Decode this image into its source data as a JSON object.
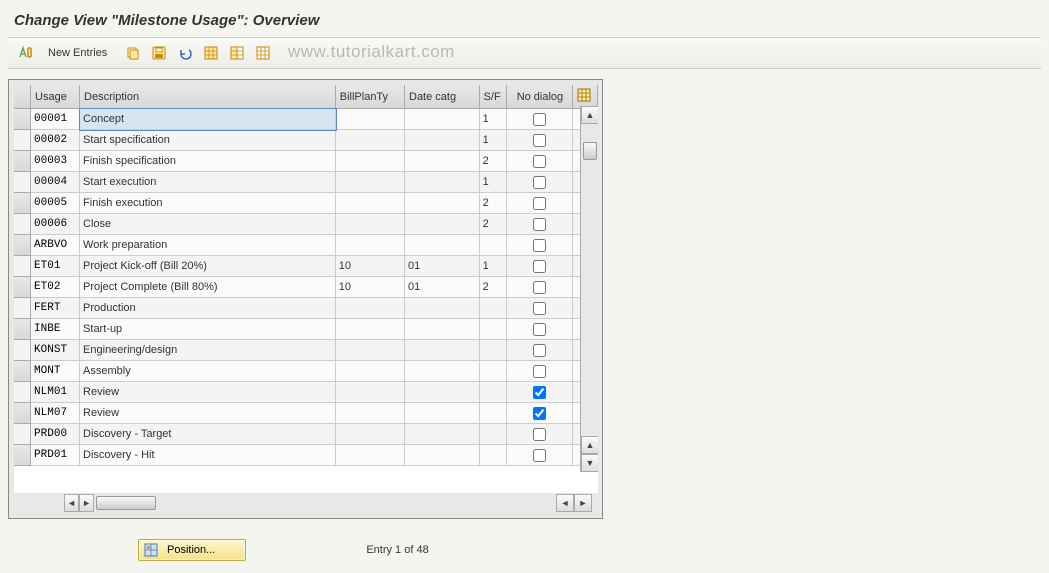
{
  "title": "Change View \"Milestone Usage\": Overview",
  "toolbar": {
    "new_entries": "New Entries"
  },
  "watermark": "www.tutorialkart.com",
  "columns": {
    "usage": "Usage",
    "description": "Description",
    "billplanty": "BillPlanTy",
    "datecatg": "Date catg",
    "sf": "S/F",
    "nodialog": "No dialog"
  },
  "rows": [
    {
      "usage": "00001",
      "description": "Concept",
      "bill": "",
      "date": "",
      "sf": "1",
      "dlg": false,
      "selected": true
    },
    {
      "usage": "00002",
      "description": "Start specification",
      "bill": "",
      "date": "",
      "sf": "1",
      "dlg": false
    },
    {
      "usage": "00003",
      "description": "Finish specification",
      "bill": "",
      "date": "",
      "sf": "2",
      "dlg": false
    },
    {
      "usage": "00004",
      "description": "Start execution",
      "bill": "",
      "date": "",
      "sf": "1",
      "dlg": false
    },
    {
      "usage": "00005",
      "description": "Finish execution",
      "bill": "",
      "date": "",
      "sf": "2",
      "dlg": false
    },
    {
      "usage": "00006",
      "description": "Close",
      "bill": "",
      "date": "",
      "sf": "2",
      "dlg": false
    },
    {
      "usage": "ARBVO",
      "description": "Work preparation",
      "bill": "",
      "date": "",
      "sf": "",
      "dlg": false
    },
    {
      "usage": "ET01",
      "description": "Project Kick-off (Bill 20%)",
      "bill": "10",
      "date": "01",
      "sf": "1",
      "dlg": false
    },
    {
      "usage": "ET02",
      "description": "Project Complete (Bill 80%)",
      "bill": "10",
      "date": "01",
      "sf": "2",
      "dlg": false
    },
    {
      "usage": "FERT",
      "description": "Production",
      "bill": "",
      "date": "",
      "sf": "",
      "dlg": false
    },
    {
      "usage": "INBE",
      "description": "Start-up",
      "bill": "",
      "date": "",
      "sf": "",
      "dlg": false
    },
    {
      "usage": "KONST",
      "description": "Engineering/design",
      "bill": "",
      "date": "",
      "sf": "",
      "dlg": false
    },
    {
      "usage": "MONT",
      "description": "Assembly",
      "bill": "",
      "date": "",
      "sf": "",
      "dlg": false
    },
    {
      "usage": "NLM01",
      "description": "Review",
      "bill": "",
      "date": "",
      "sf": "",
      "dlg": true
    },
    {
      "usage": "NLM07",
      "description": "Review",
      "bill": "",
      "date": "",
      "sf": "",
      "dlg": true
    },
    {
      "usage": "PRD00",
      "description": "Discovery - Target",
      "bill": "",
      "date": "",
      "sf": "",
      "dlg": false
    },
    {
      "usage": "PRD01",
      "description": "Discovery - Hit",
      "bill": "",
      "date": "",
      "sf": "",
      "dlg": false
    }
  ],
  "footer": {
    "position": "Position...",
    "entry": "Entry 1 of 48"
  }
}
